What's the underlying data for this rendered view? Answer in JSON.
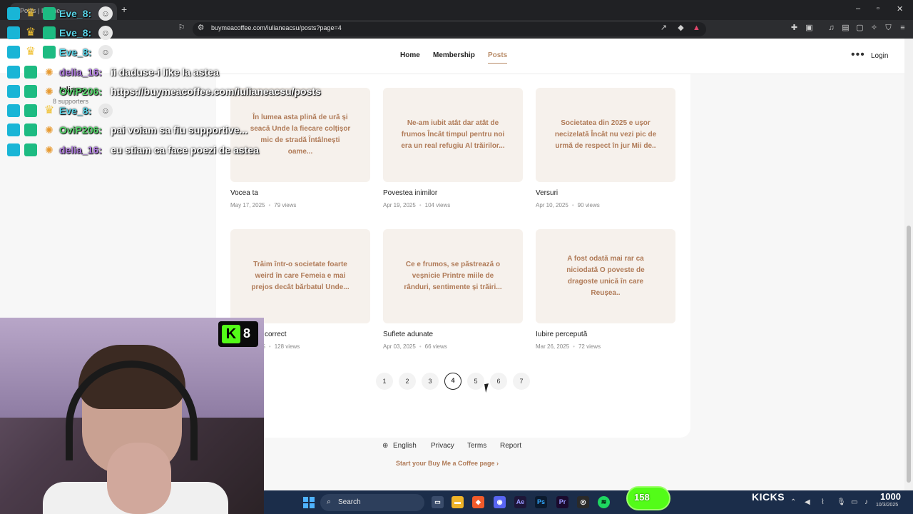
{
  "browser": {
    "tab_title": "Posts | Iuliane...",
    "url": "buymeacoffee.com/iulianeacsu/posts?page=4"
  },
  "nav": {
    "home": "Home",
    "membership": "Membership",
    "posts": "Posts",
    "login": "Login",
    "creator_name": "Iuliana",
    "creator_sub": "8 supporters"
  },
  "posts": [
    {
      "excerpt": "În lumea asta plină de ură și seacă Unde la fiecare colțișor mic de stradă Întâlnești oame...",
      "title": "Vocea ta",
      "date": "May 17, 2025",
      "views": "79 views"
    },
    {
      "excerpt": "Ne-am iubit atât dar atât de frumos Încât timpul pentru noi era un real refugiu Al trăirilor...",
      "title": "Povestea inimilor",
      "date": "Apr 19, 2025",
      "views": "104 views"
    },
    {
      "excerpt": "Societatea din 2025 e ușor necizelată Încât nu vezi pic de urmă de respect în jur  Mii de..",
      "title": "Versuri",
      "date": "Apr 10, 2025",
      "views": "90 views"
    },
    {
      "excerpt": "Trăim într-o societate foarte weird în care Femeia e mai prejos decât bărbatul Unde...",
      "title": "correct",
      "date": "25",
      "views": "128 views"
    },
    {
      "excerpt": "Ce e frumos, se păstrează o veșnicie Printre miile de rânduri, sentimente și trăiri...",
      "title": "Suflete adunate",
      "date": "Apr 03, 2025",
      "views": "66 views"
    },
    {
      "excerpt": "A fost odată mai rar ca niciodată O poveste de dragoste unică în care Reușea..",
      "title": "Iubire percepută",
      "date": "Mar 26, 2025",
      "views": "72 views"
    }
  ],
  "pagination": {
    "pages": [
      "1",
      "2",
      "3",
      "4",
      "5",
      "6",
      "7"
    ],
    "current": "4"
  },
  "footer": {
    "language": "English",
    "privacy": "Privacy",
    "terms": "Terms",
    "report": "Report",
    "start_page": "Start your Buy Me a Coffee page"
  },
  "chat": [
    {
      "user": "Eve_8:",
      "message": "",
      "color": "#59d3e6"
    },
    {
      "user": "Eve_8:",
      "message": "",
      "color": "#59d3e6"
    },
    {
      "user": "Eve_8:",
      "message": "",
      "color": "#59d3e6"
    },
    {
      "user": "delia_16:",
      "message": "ii daduse-i like la astea",
      "color": "#b07be0"
    },
    {
      "user": "OviP206:",
      "message": "https://buymeacoffee.com/iulianeacsu/posts",
      "color": "#55d46a"
    },
    {
      "user": "Eve_8:",
      "message": "",
      "color": "#59d3e6"
    },
    {
      "user": "OviP206:",
      "message": "pai voiam sa fiu supportive...",
      "color": "#55d46a"
    },
    {
      "user": "delia_16:",
      "message": "eu stiam ca face poezi de astea",
      "color": "#b07be0"
    }
  ],
  "stream": {
    "kick_viewers": "8",
    "kick_counter": "158",
    "kicks_label": "KICKS",
    "kicks_count": "1000"
  },
  "taskbar": {
    "search_label": "Search",
    "clock": "10/3/2025"
  },
  "colors": {
    "accent": "#b98d6a",
    "excerpt": "#b07b58",
    "kick_green": "#53fc18",
    "taskbar": "#1b2d4a"
  }
}
